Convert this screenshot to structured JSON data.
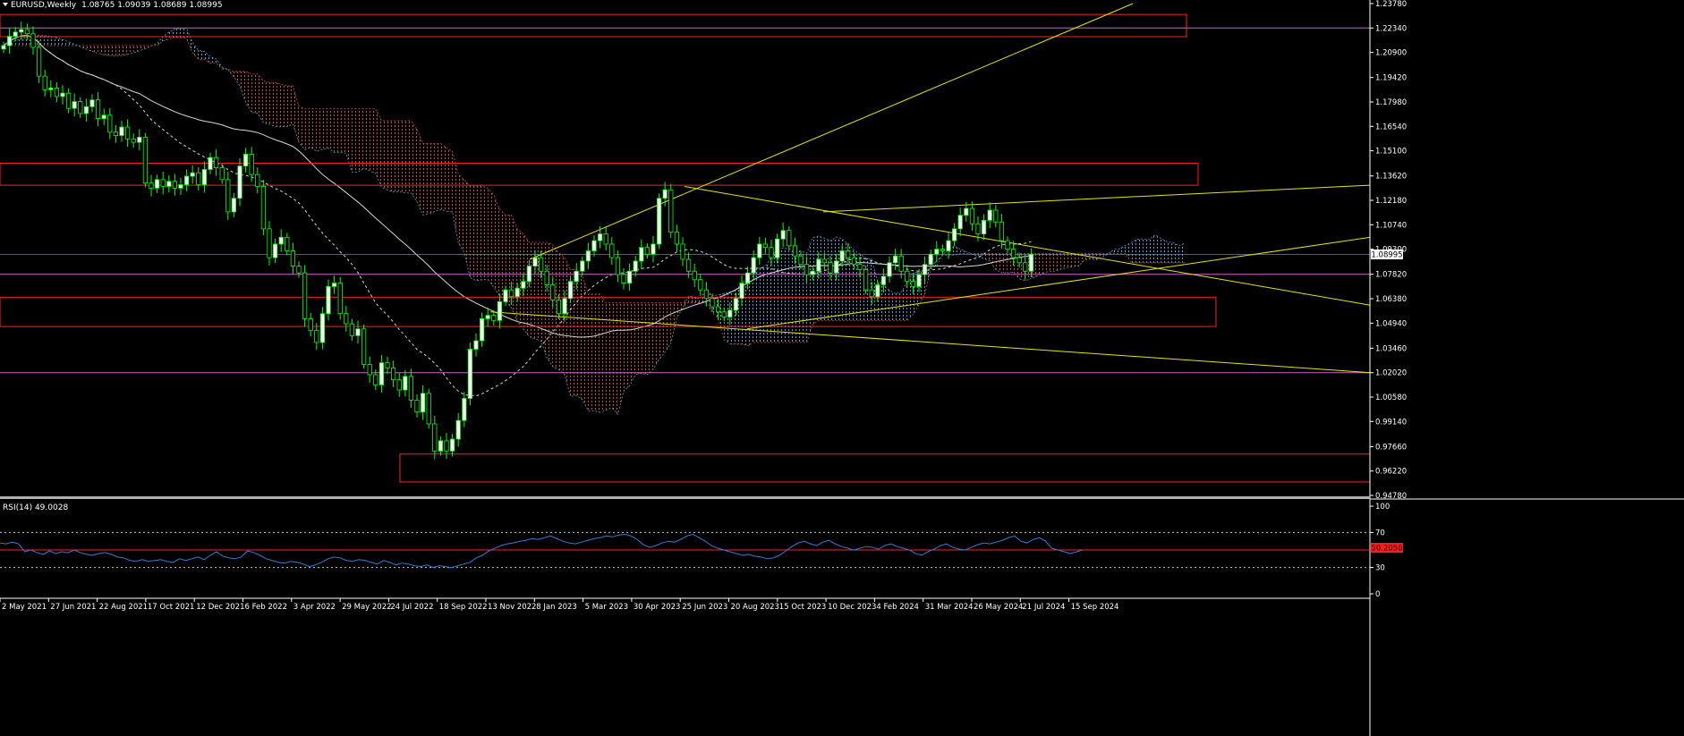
{
  "colors": {
    "background": "#000000",
    "bull_fill": "#ffffff",
    "bear_fill": "#000000",
    "wick": "#00ff00",
    "zone_box": "#ff2020",
    "level_line": "#cc66cc",
    "trend_line": "#e6e600",
    "kumo_bull": "#4aa3d8",
    "kumo_bear": "#d84a3a",
    "ma_line": "#ffffff",
    "rsi_line": "#2c7fd6",
    "rsi_level": "#ff2020",
    "price_tag": "#ffffff",
    "rsi_tag": "#ff1a1a",
    "axis_text": "#ffffff",
    "separator": "#b0b0b0"
  },
  "header": {
    "symbol": "EURUSD,Weekly",
    "ohlc": "1.08765 1.09039 1.08689 1.08995",
    "menu_icon": "triangle-down-icon"
  },
  "rsi_header": {
    "label": "RSI(14) 49.0028"
  },
  "price_tag": "1.08995",
  "rsi_tag": "50.2058",
  "chart_data": [
    {
      "type": "candlestick",
      "symbol": "EURUSD",
      "timeframe": "Weekly",
      "ylim": [
        0.9478,
        1.2378
      ],
      "y_ticks": [
        "1.23780",
        "1.22340",
        "1.20900",
        "1.19420",
        "1.17980",
        "1.16540",
        "1.15100",
        "1.13620",
        "1.12180",
        "1.10740",
        "1.09300",
        "1.07820",
        "1.06380",
        "1.04940",
        "1.03460",
        "1.02020",
        "1.00580",
        "0.99140",
        "0.97660",
        "0.96220",
        "0.94780"
      ],
      "x_tick_labels": [
        "2 May 2021",
        "27 Jun 2021",
        "22 Aug 2021",
        "17 Oct 2021",
        "12 Dec 2021",
        "6 Feb 2022",
        "3 Apr 2022",
        "29 May 2022",
        "24 Jul 2022",
        "18 Sep 2022",
        "13 Nov 2022",
        "8 Jan 2023",
        "5 Mar 2023",
        "30 Apr 2023",
        "25 Jun 2023",
        "20 Aug 2023",
        "15 Oct 2023",
        "10 Dec 2023",
        "4 Feb 2024",
        "31 Mar 2024",
        "26 May 2024",
        "21 Jul 2024",
        "15 Sep 2024"
      ],
      "close": [
        1.213,
        1.2185,
        1.221,
        1.2225,
        1.22,
        1.212,
        1.195,
        1.187,
        1.188,
        1.183,
        1.185,
        1.176,
        1.18,
        1.173,
        1.177,
        1.181,
        1.17,
        1.172,
        1.162,
        1.16,
        1.165,
        1.158,
        1.156,
        1.159,
        1.132,
        1.129,
        1.134,
        1.13,
        1.133,
        1.129,
        1.131,
        1.136,
        1.138,
        1.131,
        1.14,
        1.147,
        1.141,
        1.134,
        1.115,
        1.123,
        1.142,
        1.149,
        1.137,
        1.13,
        1.105,
        1.088,
        1.096,
        1.1,
        1.092,
        1.083,
        1.079,
        1.052,
        1.045,
        1.038,
        1.055,
        1.071,
        1.073,
        1.055,
        1.049,
        1.042,
        1.046,
        1.025,
        1.019,
        1.013,
        1.026,
        1.023,
        1.016,
        1.01,
        1.018,
        1.004,
        0.997,
        1.008,
        0.99,
        0.974,
        0.98,
        0.974,
        0.981,
        0.992,
        1.005,
        1.034,
        1.039,
        1.052,
        1.054,
        1.051,
        1.062,
        1.069,
        1.065,
        1.07,
        1.074,
        1.083,
        1.088,
        1.08,
        1.072,
        1.063,
        1.055,
        1.064,
        1.074,
        1.08,
        1.086,
        1.092,
        1.098,
        1.102,
        1.096,
        1.088,
        1.078,
        1.073,
        1.08,
        1.086,
        1.094,
        1.09,
        1.096,
        1.123,
        1.128,
        1.103,
        1.096,
        1.087,
        1.08,
        1.075,
        1.069,
        1.064,
        1.059,
        1.056,
        1.053,
        1.057,
        1.064,
        1.073,
        1.079,
        1.088,
        1.096,
        1.094,
        1.088,
        1.099,
        1.104,
        1.095,
        1.089,
        1.084,
        1.078,
        1.08,
        1.087,
        1.085,
        1.079,
        1.086,
        1.092,
        1.088,
        1.084,
        1.081,
        1.069,
        1.065,
        1.072,
        1.077,
        1.085,
        1.089,
        1.08,
        1.074,
        1.071,
        1.078,
        1.084,
        1.09,
        1.093,
        1.092,
        1.098,
        1.105,
        1.113,
        1.117,
        1.108,
        1.102,
        1.11,
        1.116,
        1.109,
        1.098,
        1.093,
        1.088,
        1.085,
        1.08,
        1.09
      ]
    },
    {
      "type": "line",
      "title": "RSI(14) 49.0028",
      "ylim": [
        0,
        100
      ],
      "y_ticks": [
        "100",
        "70",
        "50",
        "30",
        "0"
      ],
      "levels": [
        70,
        50,
        30
      ],
      "values": [
        58,
        57,
        59,
        57,
        48,
        50,
        47,
        45,
        49,
        46,
        48,
        47,
        50,
        47,
        45,
        44,
        46,
        47,
        45,
        42,
        41,
        38,
        37,
        39,
        37,
        38,
        39,
        37,
        36,
        40,
        38,
        40,
        42,
        39,
        44,
        48,
        43,
        41,
        40,
        42,
        49,
        47,
        44,
        40,
        38,
        36,
        35,
        37,
        36,
        34,
        31,
        33,
        36,
        40,
        42,
        41,
        38,
        37,
        39,
        38,
        36,
        34,
        38,
        36,
        33,
        35,
        34,
        32,
        31,
        33,
        30,
        32,
        31,
        30,
        32,
        34,
        36,
        41,
        44,
        49,
        52,
        55,
        57,
        58,
        60,
        61,
        63,
        62,
        64,
        66,
        63,
        60,
        58,
        57,
        59,
        61,
        63,
        64,
        66,
        65,
        67,
        68,
        66,
        62,
        56,
        53,
        55,
        58,
        60,
        59,
        62,
        66,
        68,
        64,
        60,
        55,
        52,
        50,
        48,
        46,
        44,
        45,
        43,
        42,
        40,
        41,
        44,
        49,
        54,
        58,
        60,
        57,
        55,
        59,
        61,
        57,
        54,
        52,
        50,
        52,
        54,
        53,
        51,
        55,
        57,
        54,
        52,
        50,
        46,
        44,
        48,
        51,
        55,
        57,
        53,
        51,
        50,
        53,
        56,
        58,
        57,
        59,
        61,
        64,
        66,
        60,
        58,
        62,
        64,
        60,
        52,
        50,
        48,
        46,
        48,
        50
      ]
    }
  ]
}
